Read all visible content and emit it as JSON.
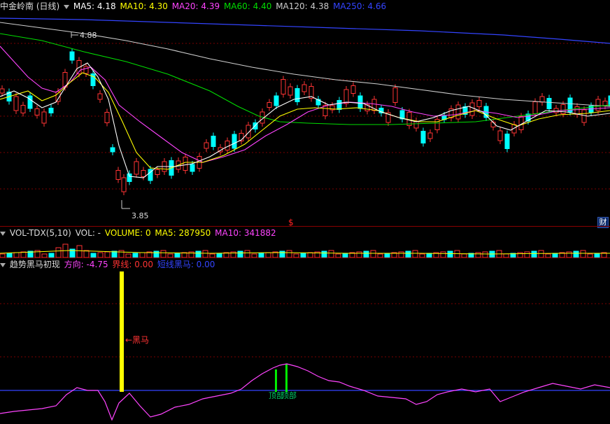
{
  "main": {
    "title": "中金岭南 (日线)",
    "ma": [
      {
        "label": "MA5: 4.18",
        "color": "#ffffff"
      },
      {
        "label": "MA10: 4.30",
        "color": "#ffff00"
      },
      {
        "label": "MA20: 4.39",
        "color": "#ff44ff"
      },
      {
        "label": "MA60: 4.40",
        "color": "#00dd00"
      },
      {
        "label": "MA120: 4.38",
        "color": "#cccccc"
      },
      {
        "label": "MA250: 4.66",
        "color": "#3344ff"
      }
    ],
    "high_label": "4.88",
    "low_label": "3.85",
    "marker": "$",
    "fin_badge": "财"
  },
  "volume": {
    "name": "VOL-TDX(5,10)",
    "vol_label": "VOL: -",
    "volume_label": "VOLUME: 0",
    "ma5_label": "MA5: 287950",
    "ma10_label": "MA10: 341882",
    "colors": {
      "up": "#ff3333",
      "down": "#00ffff",
      "ma5": "#ffff00",
      "ma10": "#ff44ff"
    }
  },
  "indicator": {
    "name": "趋势黑马初现",
    "fx_label": "方向: -4.75",
    "jx_label": "界线: 0.00",
    "bm_label": "短线黑马: 0.00",
    "horse_label": "←黑马",
    "top_label": "顶部",
    "top_label2": "顶部",
    "colors": {
      "fx": "#ff44ff",
      "jx": "#ff3333",
      "bm": "#3344ff"
    }
  }
}
